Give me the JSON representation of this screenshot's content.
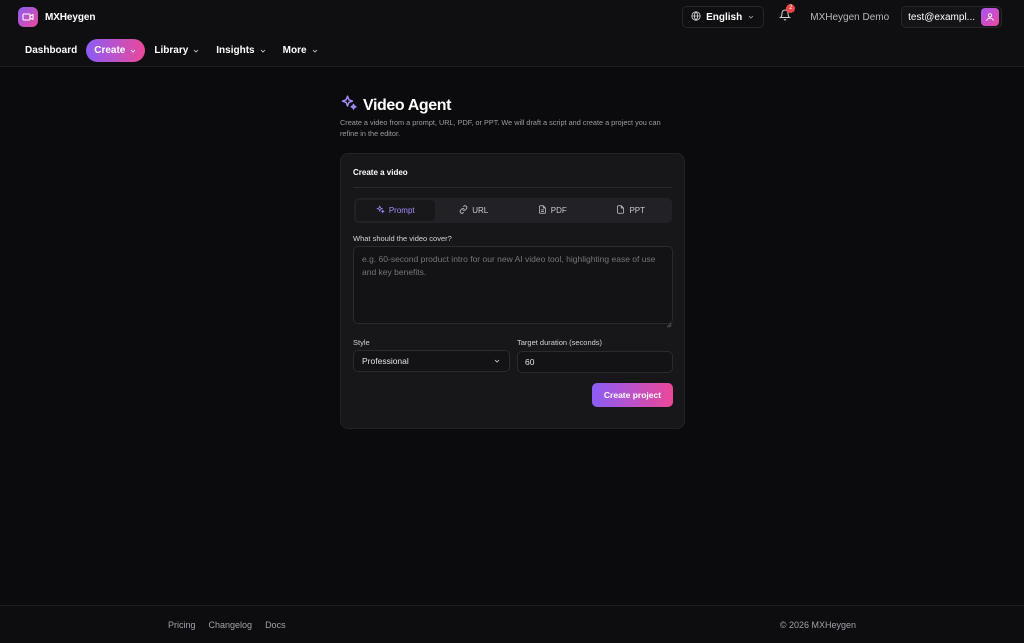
{
  "header": {
    "brand": "MXHeygen",
    "language": "English",
    "notification_count": "2",
    "workspace": "MXHeygen Demo",
    "account_email": "test@exampl..."
  },
  "nav": {
    "dashboard": "Dashboard",
    "create": "Create",
    "library": "Library",
    "insights": "Insights",
    "more": "More"
  },
  "page": {
    "title": "Video Agent",
    "subtitle": "Create a video from a prompt, URL, PDF, or PPT. We will draft a script and create a project you can refine in the editor."
  },
  "card": {
    "title": "Create a video",
    "tabs": [
      {
        "label": "Prompt",
        "icon": "sparkles-icon",
        "active": true
      },
      {
        "label": "URL",
        "icon": "link-icon",
        "active": false
      },
      {
        "label": "PDF",
        "icon": "file-icon",
        "active": false
      },
      {
        "label": "PPT",
        "icon": "file-icon",
        "active": false
      }
    ],
    "prompt_label": "What should the video cover?",
    "prompt_placeholder": "e.g. 60-second product intro for our new AI video tool, highlighting ease of use and key benefits.",
    "style_label": "Style",
    "style_value": "Professional",
    "duration_label": "Target duration (seconds)",
    "duration_value": "60",
    "submit_label": "Create project"
  },
  "footer": {
    "links": [
      "Pricing",
      "Changelog",
      "Docs"
    ],
    "copyright": "© 2026 MXHeygen"
  },
  "colors": {
    "background": "#0b0b0d",
    "accent_start": "#8b5cf6",
    "accent_end": "#ec4899",
    "active_tab_text": "#a78bfa"
  }
}
